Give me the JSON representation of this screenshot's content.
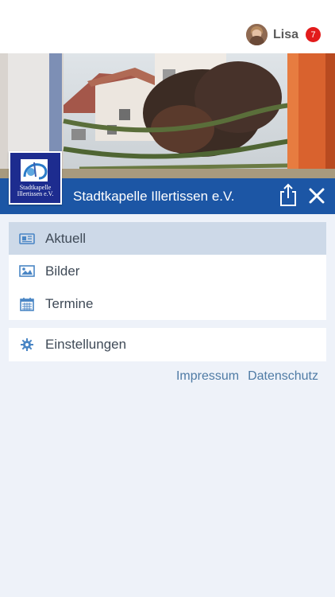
{
  "header": {
    "user_name": "Lisa",
    "notification_count": "7"
  },
  "club": {
    "name": "Stadtkapelle Illertissen e.V.",
    "logo_text": "Stadtkapelle Illertissen e.V."
  },
  "menu": {
    "items": [
      {
        "label": "Aktuell",
        "icon": "newspaper-icon",
        "active": true
      },
      {
        "label": "Bilder",
        "icon": "image-icon",
        "active": false
      },
      {
        "label": "Termine",
        "icon": "calendar-icon",
        "active": false
      }
    ],
    "settings": {
      "label": "Einstellungen",
      "icon": "gear-icon"
    }
  },
  "footer": {
    "impressum": "Impressum",
    "datenschutz": "Datenschutz"
  },
  "colors": {
    "brand_blue": "#1c56a5",
    "active_row": "#cdd9e8",
    "badge_red": "#e21b1b",
    "link": "#4f7ba5",
    "icon": "#4a86c5"
  }
}
